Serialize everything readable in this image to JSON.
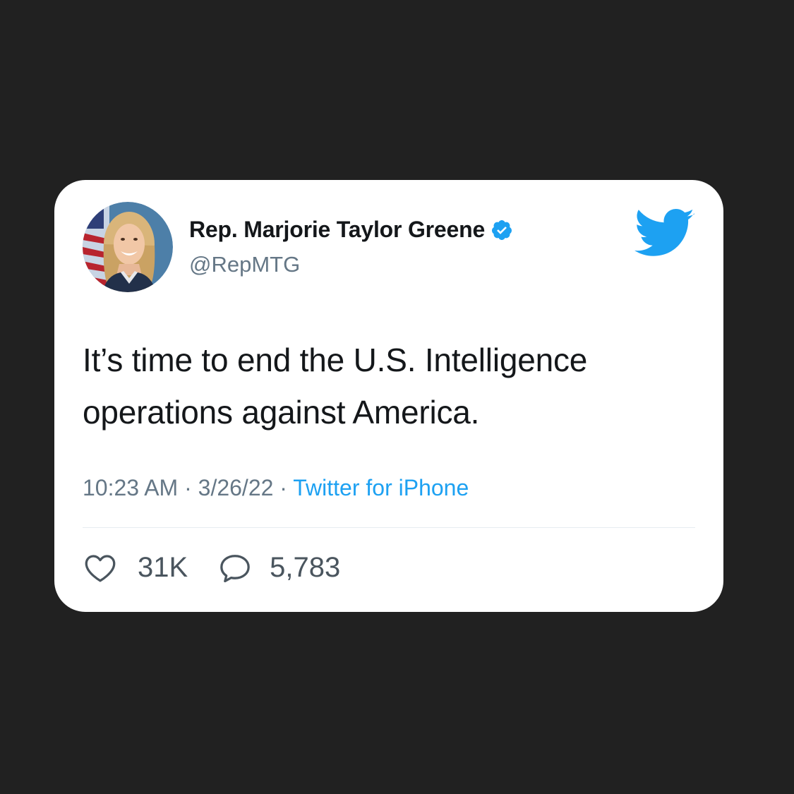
{
  "tweet": {
    "author": {
      "name": "Rep. Marjorie Taylor Greene",
      "handle": "@RepMTG",
      "verified": true,
      "avatar_icon": "portrait-photo"
    },
    "text_lines": [
      "It’s time to end the U.S. Intelligence",
      "operations against America."
    ],
    "meta": {
      "time": "10:23 AM",
      "separator": " · ",
      "date": "3/26/22",
      "source": "Twitter for iPhone"
    },
    "stats": {
      "likes": "31K",
      "replies": "5,783"
    },
    "icons": {
      "brand": "twitter-bird-icon",
      "like": "heart-icon",
      "reply": "speech-bubble-icon",
      "verified": "verified-badge-icon"
    }
  },
  "colors": {
    "background": "#212121",
    "card": "#ffffff",
    "brand_blue": "#1da1f2",
    "secondary_text": "#657786",
    "primary_text": "#14171a"
  }
}
